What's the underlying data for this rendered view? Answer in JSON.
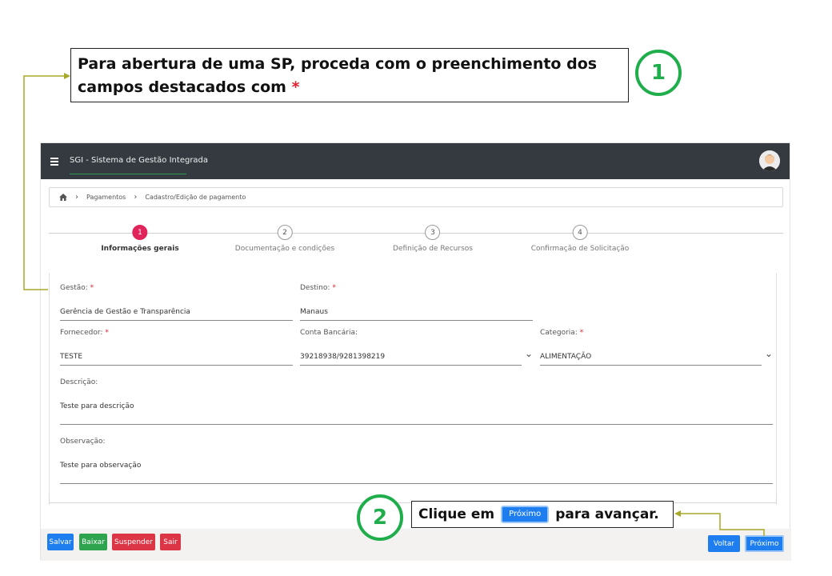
{
  "callout1": {
    "text": "Para abertura de uma SP, proceda com o preenchimento dos campos destacados com",
    "asterisk": "*",
    "number": "1"
  },
  "callout2": {
    "prefix": "Clique em",
    "button": "Próximo",
    "suffix": "para avançar.",
    "number": "2"
  },
  "header": {
    "title": "SGI - Sistema de Gestão Integrada",
    "menu_icon": "hamburger-icon",
    "avatar_icon": "user-avatar-icon",
    "bg_color": "#343a40"
  },
  "breadcrumb": {
    "home_icon": "home-icon",
    "items": [
      "Pagamentos",
      "Cadastro/Edição de pagamento"
    ]
  },
  "stepper": {
    "active_color": "#e0255b",
    "steps": [
      {
        "number": "1",
        "label": "Informações gerais",
        "active": true
      },
      {
        "number": "2",
        "label": "Documentação e condições",
        "active": false
      },
      {
        "number": "3",
        "label": "Definição de Recursos",
        "active": false
      },
      {
        "number": "4",
        "label": "Confirmação de Solicitação",
        "active": false
      }
    ]
  },
  "form": {
    "gestao": {
      "label": "Gestão:",
      "required": "*",
      "value": "Gerência de Gestão e Transparência"
    },
    "destino": {
      "label": "Destino:",
      "required": "*",
      "value": "Manaus"
    },
    "fornecedor": {
      "label": "Fornecedor:",
      "required": "*",
      "value": "TESTE"
    },
    "conta": {
      "label": "Conta Bancária:",
      "value": "39218938/9281398219"
    },
    "categoria": {
      "label": "Categoria:",
      "required": "*",
      "value": "ALIMENTAÇÃO"
    },
    "descricao": {
      "label": "Descrição:",
      "value": "Teste para descrição"
    },
    "observacao": {
      "label": "Observação:",
      "value": "Teste para observação"
    }
  },
  "footer": {
    "salvar": "Salvar",
    "baixar": "Baixar",
    "suspender": "Suspender",
    "sair": "Sair",
    "voltar": "Voltar",
    "proximo": "Próximo"
  },
  "colors": {
    "primary": "#1e7ef0",
    "success": "#2ea44f",
    "danger": "#dc3545",
    "callout_green": "#1fae4b",
    "connector": "#a8a82a"
  }
}
